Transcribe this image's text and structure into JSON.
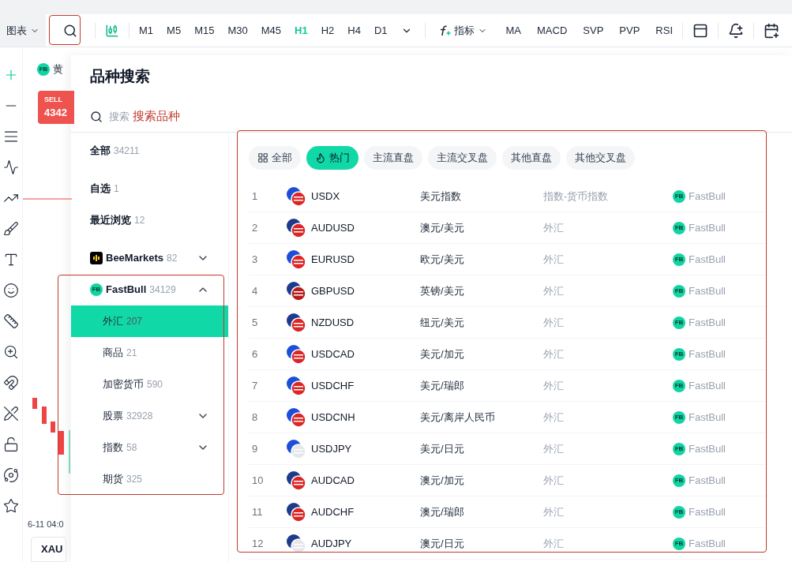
{
  "toolbar": {
    "chart_menu": "图表",
    "timeframes": [
      {
        "label": "M1",
        "selected": false
      },
      {
        "label": "M5",
        "selected": false
      },
      {
        "label": "M15",
        "selected": false
      },
      {
        "label": "M30",
        "selected": false
      },
      {
        "label": "M45",
        "selected": false
      },
      {
        "label": "H1",
        "selected": true
      },
      {
        "label": "H2",
        "selected": false
      },
      {
        "label": "H4",
        "selected": false
      },
      {
        "label": "D1",
        "selected": false
      }
    ],
    "indicators_menu": "指标",
    "indicators": [
      "MA",
      "MACD",
      "SVP",
      "PVP",
      "RSI"
    ]
  },
  "chart": {
    "symbol_logo": "FB",
    "symbol": "黄",
    "sell_label": "SELL",
    "sell_price": "4342",
    "time_label": "6-11 04:0",
    "tab": "XAU"
  },
  "dialog": {
    "title": "品种搜索",
    "search": {
      "placeholder": "搜索"
    },
    "nav": [
      {
        "label": "全部",
        "count": "34211",
        "kind": "plain"
      },
      {
        "label": "自选",
        "count": "1",
        "kind": "plain"
      },
      {
        "label": "最近浏览",
        "count": "12",
        "kind": "plain"
      },
      {
        "label": "BeeMarkets",
        "count": "82",
        "kind": "bee",
        "expanded": false
      },
      {
        "label": "FastBull",
        "count": "34129",
        "kind": "fb",
        "logo": "FB",
        "expanded": true,
        "children": [
          {
            "label": "外汇",
            "count": "207",
            "selected": true
          },
          {
            "label": "商品",
            "count": "21",
            "selected": false
          },
          {
            "label": "加密货币",
            "count": "590",
            "selected": false
          },
          {
            "label": "股票",
            "count": "32928",
            "selected": false,
            "expanded": false
          },
          {
            "label": "指数",
            "count": "58",
            "selected": false,
            "expanded": false
          },
          {
            "label": "期货",
            "count": "325",
            "selected": false
          }
        ]
      }
    ],
    "filters": [
      {
        "label": "全部",
        "kind": "grid",
        "selected": false
      },
      {
        "label": "热门",
        "kind": "hot",
        "selected": true
      },
      {
        "label": "主流直盘",
        "kind": "plain",
        "selected": false
      },
      {
        "label": "主流交叉盘",
        "kind": "plain",
        "selected": false
      },
      {
        "label": "其他直盘",
        "kind": "plain",
        "selected": false
      },
      {
        "label": "其他交叉盘",
        "kind": "plain",
        "selected": false
      }
    ],
    "rows": [
      {
        "index": "1",
        "symbol": "USDX",
        "name": "美元指数",
        "category": "指数-货币指数",
        "source_logo": "FB",
        "source": "FastBull"
      },
      {
        "index": "2",
        "symbol": "AUDUSD",
        "name": "澳元/美元",
        "category": "外汇",
        "source_logo": "FB",
        "source": "FastBull"
      },
      {
        "index": "3",
        "symbol": "EURUSD",
        "name": "欧元/美元",
        "category": "外汇",
        "source_logo": "FB",
        "source": "FastBull"
      },
      {
        "index": "4",
        "symbol": "GBPUSD",
        "name": "英镑/美元",
        "category": "外汇",
        "source_logo": "FB",
        "source": "FastBull"
      },
      {
        "index": "5",
        "symbol": "NZDUSD",
        "name": "纽元/美元",
        "category": "外汇",
        "source_logo": "FB",
        "source": "FastBull"
      },
      {
        "index": "6",
        "symbol": "USDCAD",
        "name": "美元/加元",
        "category": "外汇",
        "source_logo": "FB",
        "source": "FastBull"
      },
      {
        "index": "7",
        "symbol": "USDCHF",
        "name": "美元/瑞郎",
        "category": "外汇",
        "source_logo": "FB",
        "source": "FastBull"
      },
      {
        "index": "8",
        "symbol": "USDCNH",
        "name": "美元/离岸人民币",
        "category": "外汇",
        "source_logo": "FB",
        "source": "FastBull"
      },
      {
        "index": "9",
        "symbol": "USDJPY",
        "name": "美元/日元",
        "category": "外汇",
        "source_logo": "FB",
        "source": "FastBull"
      },
      {
        "index": "10",
        "symbol": "AUDCAD",
        "name": "澳元/加元",
        "category": "外汇",
        "source_logo": "FB",
        "source": "FastBull"
      },
      {
        "index": "11",
        "symbol": "AUDCHF",
        "name": "澳元/瑞郎",
        "category": "外汇",
        "source_logo": "FB",
        "source": "FastBull"
      },
      {
        "index": "12",
        "symbol": "AUDJPY",
        "name": "澳元/日元",
        "category": "外汇",
        "source_logo": "FB",
        "source": "FastBull"
      }
    ]
  },
  "annotation": {
    "label": "搜索品种"
  }
}
